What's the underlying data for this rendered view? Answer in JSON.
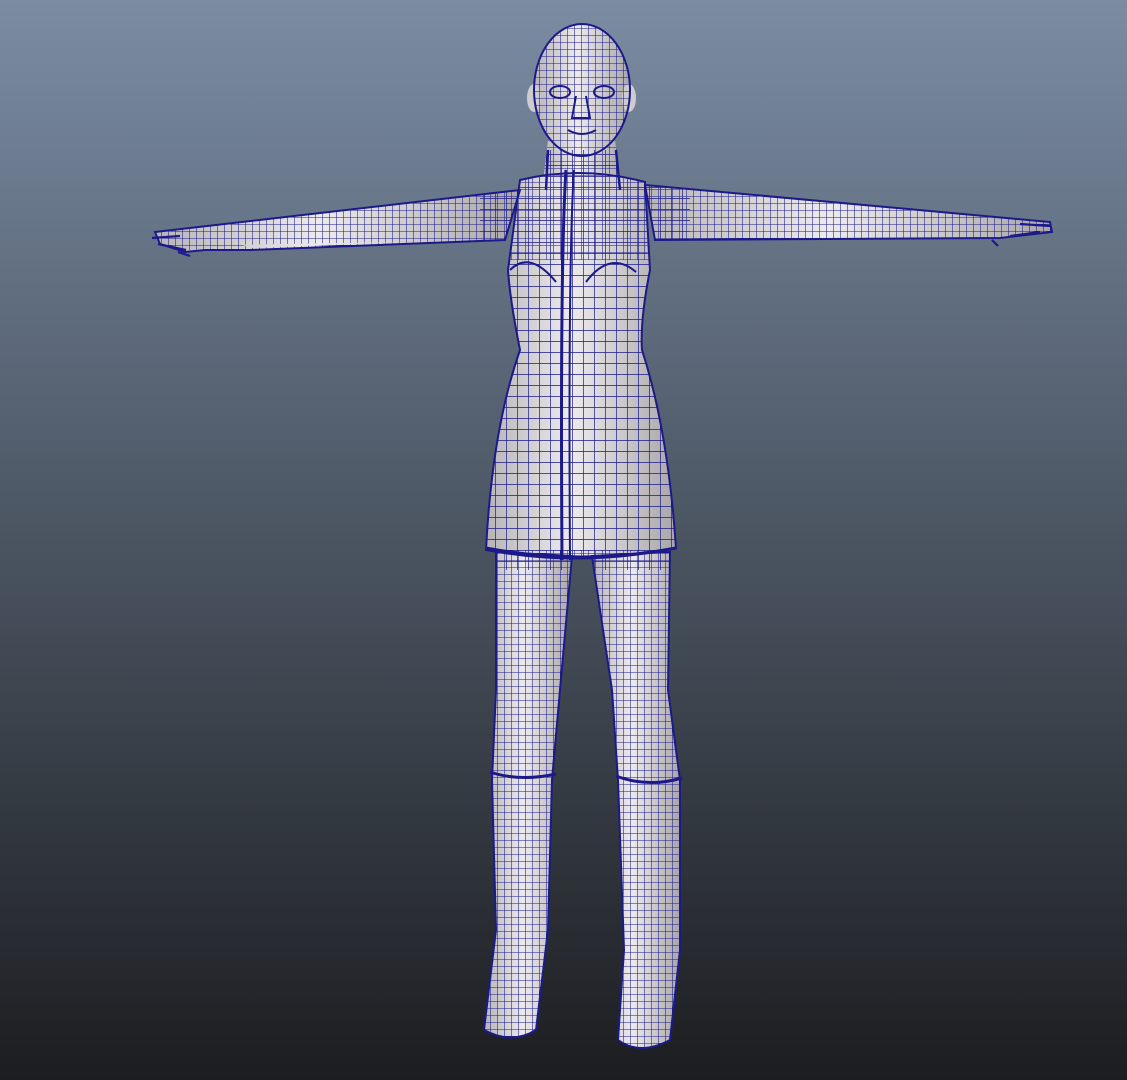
{
  "viewport": {
    "background_top": "#7b8ca3",
    "background_bottom": "#1c1d20"
  },
  "model": {
    "name": "t-pose-character-mesh",
    "display_mode": "wireframe-on-shaded",
    "surface_color": "#e6e3e5",
    "surface_shade": "#a9a6aa",
    "wire_color": "#1c1a8a"
  }
}
